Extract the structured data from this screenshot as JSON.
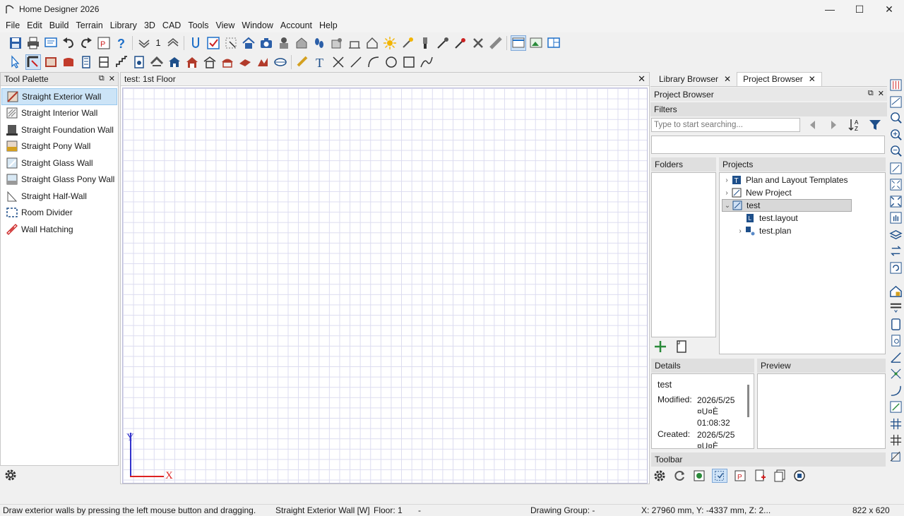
{
  "window": {
    "title": "Home Designer 2026",
    "minimize": "—",
    "maximize": "☐",
    "close": "✕"
  },
  "menu": [
    "File",
    "Edit",
    "Build",
    "Terrain",
    "Library",
    "3D",
    "CAD",
    "Tools",
    "View",
    "Window",
    "Account",
    "Help"
  ],
  "toolbar1": {
    "floor_number": "1"
  },
  "tool_palette": {
    "title": "Tool Palette",
    "float": "⧉",
    "close": "✕",
    "items": [
      {
        "label": "Straight Exterior Wall",
        "icon": "exterior-wall-icon",
        "selected": true
      },
      {
        "label": "Straight Interior Wall",
        "icon": "interior-wall-icon"
      },
      {
        "label": "Straight Foundation Wall",
        "icon": "foundation-wall-icon"
      },
      {
        "label": "Straight Pony Wall",
        "icon": "pony-wall-icon"
      },
      {
        "label": "Straight Glass Wall",
        "icon": "glass-wall-icon"
      },
      {
        "label": "Straight Glass Pony Wall",
        "icon": "glass-pony-wall-icon"
      },
      {
        "label": "Straight Half-Wall",
        "icon": "half-wall-icon"
      },
      {
        "label": "Room Divider",
        "icon": "room-divider-icon"
      },
      {
        "label": "Wall Hatching",
        "icon": "wall-hatching-icon"
      }
    ]
  },
  "drawing": {
    "tab_title": "test: 1st Floor",
    "close": "✕",
    "axis_y": "Y",
    "axis_x": "X"
  },
  "right_panel": {
    "tabs": [
      {
        "label": "Library Browser",
        "close": "✕"
      },
      {
        "label": "Project Browser",
        "close": "✕",
        "active": true
      }
    ],
    "project_browser_title": "Project Browser",
    "float": "⧉",
    "close": "✕",
    "filters_label": "Filters",
    "search_placeholder": "Type to start searching...",
    "folders_label": "Folders",
    "projects_label": "Projects",
    "projects": [
      {
        "label": "Plan and Layout Templates",
        "arrow": "›"
      },
      {
        "label": "New Project",
        "arrow": "›"
      },
      {
        "label": "test",
        "arrow": "⌄",
        "selected": true
      },
      {
        "label": "test.layout",
        "arrow": ""
      },
      {
        "label": "test.plan",
        "arrow": "›"
      }
    ],
    "details_label": "Details",
    "preview_label": "Preview",
    "details": {
      "name": "test",
      "modified_label": "Modified:",
      "modified_value_1": "2026/5/25",
      "modified_value_2": "¤U¤È",
      "modified_value_3": "01:08:32",
      "created_label": "Created:",
      "created_value_1": "2026/5/25",
      "created_value_2": "¤U¤È"
    },
    "toolbar_label": "Toolbar"
  },
  "status": {
    "hint": "Draw exterior walls by pressing the left mouse button and dragging.",
    "tool": "Straight Exterior Wall [W]",
    "floor": "Floor: 1",
    "dash": "-",
    "drawing_group": "Drawing Group: -",
    "coords": "X: 27960 mm, Y: -4337 mm, Z: 2...",
    "size": "822 x 620"
  },
  "colors": {
    "accent_blue": "#1e6fc8",
    "selection": "#cce4f7",
    "grid_line": "#dcdcf0",
    "axis_y": "#3333cc",
    "axis_x": "#dd2222"
  }
}
